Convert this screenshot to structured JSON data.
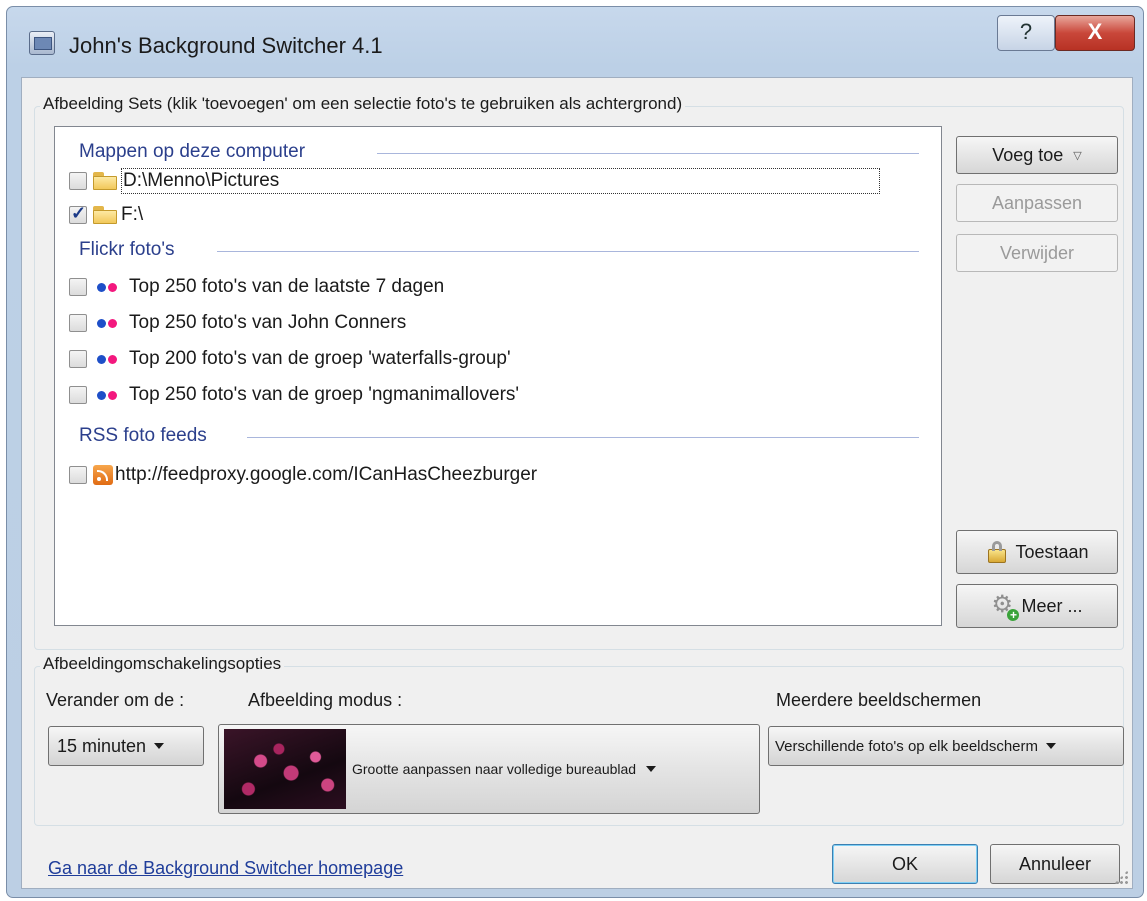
{
  "window": {
    "title": "John's Background Switcher 4.1",
    "help_label": "?",
    "close_label": "X"
  },
  "sets_group": {
    "label": "Afbeelding Sets (klik 'toevoegen' om een selectie foto's te gebruiken als achtergrond)",
    "sections": {
      "folders": {
        "title": "Mappen op deze computer",
        "items": [
          {
            "label": "D:\\Menno\\Pictures",
            "checked": false,
            "icon": "folder-icon"
          },
          {
            "label": "F:\\",
            "checked": true,
            "icon": "folder-icon"
          }
        ]
      },
      "flickr": {
        "title": "Flickr foto's",
        "items": [
          {
            "label": "Top 250 foto's van de laatste 7 dagen",
            "checked": false,
            "icon": "flickr-icon"
          },
          {
            "label": "Top 250 foto's van John Conners",
            "checked": false,
            "icon": "flickr-icon"
          },
          {
            "label": "Top 200 foto's van de groep 'waterfalls-group'",
            "checked": false,
            "icon": "flickr-icon"
          },
          {
            "label": "Top 250 foto's van de groep 'ngmanimallovers'",
            "checked": false,
            "icon": "flickr-icon"
          }
        ]
      },
      "rss": {
        "title": "RSS foto feeds",
        "items": [
          {
            "label": "http://feedproxy.google.com/ICanHasCheezburger",
            "checked": false,
            "icon": "rss-icon"
          }
        ]
      }
    },
    "buttons": {
      "add": "Voeg toe",
      "edit": "Aanpassen",
      "remove": "Verwijder",
      "allow": "Toestaan",
      "more": "Meer ..."
    }
  },
  "options_group": {
    "label": "Afbeeldingomschakelingsopties",
    "interval_label": "Verander om de :",
    "interval_value": "15 minuten",
    "mode_label": "Afbeelding modus :",
    "mode_value": "Grootte aanpassen naar volledige bureaublad",
    "monitors_label": "Meerdere beeldschermen",
    "monitors_value": "Verschillende foto's op elk beeldscherm"
  },
  "footer": {
    "homepage_link": "Ga naar de Background Switcher homepage",
    "ok": "OK",
    "cancel": "Annuleer"
  },
  "colors": {
    "section_title": "#2b3f8c",
    "link": "#1f3d9a",
    "close_button": "#c9473a"
  }
}
